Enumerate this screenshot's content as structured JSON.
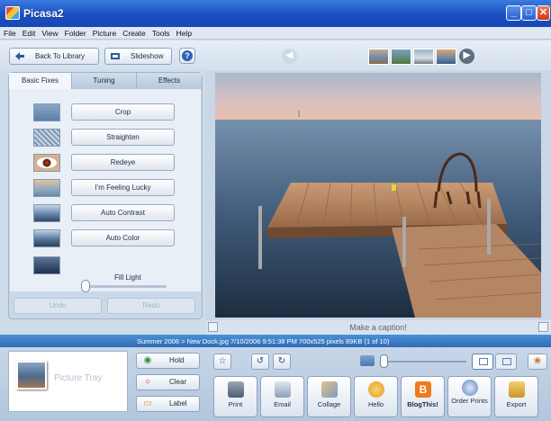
{
  "window": {
    "title": "Picasa2"
  },
  "menu": [
    "File",
    "Edit",
    "View",
    "Folder",
    "Picture",
    "Create",
    "Tools",
    "Help"
  ],
  "toolbar": {
    "back_label": "Back To Library",
    "slideshow_label": "Slideshow",
    "help_label": "?"
  },
  "tabs": [
    {
      "label": "Basic Fixes",
      "active": true
    },
    {
      "label": "Tuning",
      "active": false
    },
    {
      "label": "Effects",
      "active": false
    }
  ],
  "fixes": [
    {
      "label": "Crop",
      "icon": "crop-icon"
    },
    {
      "label": "Straighten",
      "icon": "straighten-icon"
    },
    {
      "label": "Redeye",
      "icon": "redeye-icon"
    },
    {
      "label": "I'm Feeling Lucky",
      "icon": "feeling-lucky-icon"
    },
    {
      "label": "Auto Contrast",
      "icon": "auto-contrast-icon"
    },
    {
      "label": "Auto Color",
      "icon": "auto-color-icon"
    }
  ],
  "fill_light": {
    "label": "Fill Light",
    "value": 0
  },
  "history": {
    "undo_label": "Undo",
    "redo_label": "Redo"
  },
  "caption": {
    "placeholder": "Make a caption!"
  },
  "info": {
    "text": "Summer 2006 > New Dock.jpg    7/10/2006 9:51:38 PM    700x525 pixels    89KB    (1 of 10)"
  },
  "tray": {
    "label": "Picture Tray",
    "hold_label": "Hold",
    "clear_label": "Clear",
    "label_label": "Label"
  },
  "actions": [
    {
      "label": "Print",
      "icon": "print-icon"
    },
    {
      "label": "Email",
      "icon": "email-icon"
    },
    {
      "label": "Collage",
      "icon": "collage-icon"
    },
    {
      "label": "Hello",
      "icon": "hello-icon"
    },
    {
      "label": "BlogThis!",
      "icon": "blogger-icon"
    },
    {
      "label": "Order Prints",
      "icon": "order-prints-icon"
    },
    {
      "label": "Export",
      "icon": "export-icon"
    }
  ],
  "colors": {
    "titlebar": "#1b4fc2",
    "infobar": "#2f6cb6",
    "panel": "#cad8e8"
  }
}
